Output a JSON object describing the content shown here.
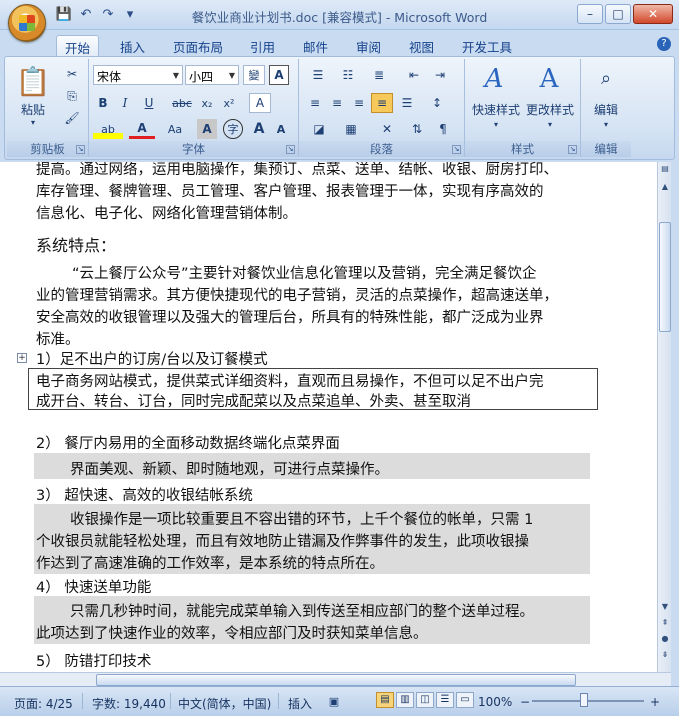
{
  "window": {
    "title": "餐饮业商业计划书.doc [兼容模式] - Microsoft Word",
    "controls": {
      "minimize": "–",
      "maximize": "□",
      "close": "✕"
    }
  },
  "qat": {
    "save_icon": "💾",
    "undo_icon": "↶",
    "redo_icon": "↷",
    "customize_icon": "▾"
  },
  "tabs": [
    "开始",
    "插入",
    "页面布局",
    "引用",
    "邮件",
    "审阅",
    "视图",
    "开发工具"
  ],
  "help": "?",
  "ribbon": {
    "clipboard": {
      "label": "剪贴板",
      "paste": "粘贴",
      "paste_icon": "📋",
      "cut_icon": "✂",
      "copy_icon": "⎘",
      "format_painter_icon": "🖌"
    },
    "font": {
      "label": "字体",
      "font_name": "宋体",
      "font_size": "小四",
      "phonetic": "變",
      "char_border": "A",
      "bold": "B",
      "italic": "I",
      "underline": "U",
      "strike": "abc",
      "subscript": "x₂",
      "superscript": "x²",
      "clear_format": "A",
      "highlight": "ab",
      "font_color": "A",
      "change_case": "Aa",
      "char_shading": "A",
      "enclose": "字",
      "grow": "A",
      "shrink": "A"
    },
    "paragraph": {
      "label": "段落"
    },
    "styles": {
      "label": "样式",
      "quick_styles": "快速样式",
      "change_styles": "更改样式"
    },
    "editing": {
      "label": "编辑",
      "editing": "编辑"
    }
  },
  "document": {
    "line1": "提高。通过网络，运用电脑操作，集预订、点菜、送单、结帐、收银、厨房打印、",
    "line2": "库存管理、餐牌管理、员工管理、客户管理、报表管理于一体，实现有序高效的",
    "line3": "信息化、电子化、网络化管理营销体制。",
    "heading": "系统特点：",
    "p1_l1": "“云上餐厅公众号”主要针对餐饮业信息化管理以及营销，完全满足餐饮企",
    "p1_l2": "业的管理营销需求。其方便快捷现代的电子营销，灵活的点菜操作，超高速送单，",
    "p1_l3": "安全高效的收银管理以及强大的管理后台，所具有的特殊性能，都广泛成为业界",
    "p1_l4": "标准。",
    "item1": "1）足不出户的订房/台以及订餐模式",
    "item1_l1": "电子商务网站模式，提供菜式详细资料，直观而且易操作，不但可以足不出户完",
    "item1_l2": "成开台、转台、订台，同时完成配菜以及点菜追单、外卖、甚至取消",
    "item2": "2）  餐厅内易用的全面移动数据终端化点菜界面",
    "item2_l1": "界面美观、新颖、即时随地观，可进行点菜操作。",
    "item3": "3）  超快速、高效的收银结帐系统",
    "item3_l1": "收银操作是一项比较重要且不容出错的环节，上千个餐位的帐单，只需 1",
    "item3_l2": "个收银员就能轻松处理，而且有效地防止错漏及作弊事件的发生，此项收银操",
    "item3_l3": "作达到了高速准确的工作效率，是本系统的特点所在。",
    "item4": "4）  快速送单功能",
    "item4_l1": "只需几秒钟时间，就能完成菜单输入到传送至相应部门的整个送单过程。",
    "item4_l2": "此项达到了快速作业的效率，令相应部门及时获知菜单信息。",
    "item5": "5）  防错打印技术",
    "anchor": "+"
  },
  "status": {
    "page": "页面: 4/25",
    "words": "字数: 19,440",
    "language": "中文(简体，中国)",
    "insert": "插入",
    "zoom": "100%",
    "zoom_minus": "−",
    "zoom_plus": "+"
  }
}
